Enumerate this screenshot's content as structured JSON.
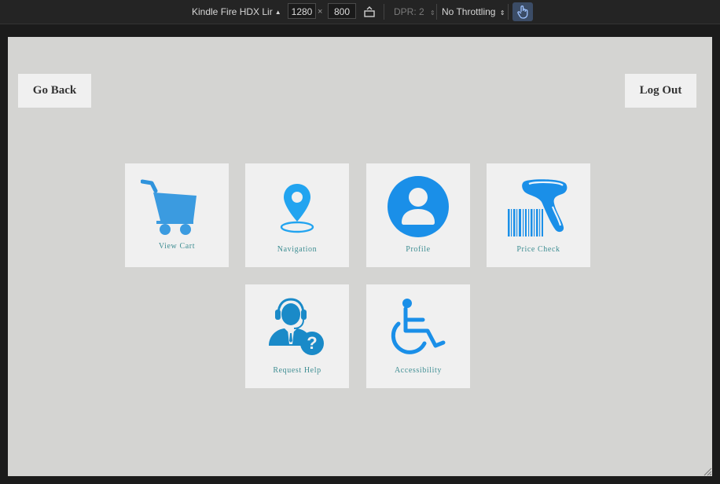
{
  "devtools": {
    "device_name": "Kindle Fire HDX",
    "device_suffix": "Lir",
    "width": "1280",
    "times": "×",
    "height": "800",
    "dpr": "DPR: 2",
    "throttling": "No Throttling",
    "icons": [
      "rotate-icon",
      "touch-icon",
      "resize-grip-icon"
    ]
  },
  "app": {
    "go_back": "Go Back",
    "log_out": "Log Out",
    "tiles": [
      {
        "label": "View Cart",
        "icon": "shopping-cart-icon"
      },
      {
        "label": "Navigation",
        "icon": "location-pin-icon"
      },
      {
        "label": "Profile",
        "icon": "user-profile-icon"
      },
      {
        "label": "Price Check",
        "icon": "barcode-scanner-icon"
      },
      {
        "label": "Request Help",
        "icon": "support-agent-icon"
      },
      {
        "label": "Accessibility",
        "icon": "wheelchair-icon"
      }
    ],
    "colors": {
      "icon_blue": "#1e90e0",
      "label_teal": "#3f8e93",
      "tile_bg": "#f0f0f0",
      "page_bg": "#d4d4d2"
    }
  }
}
